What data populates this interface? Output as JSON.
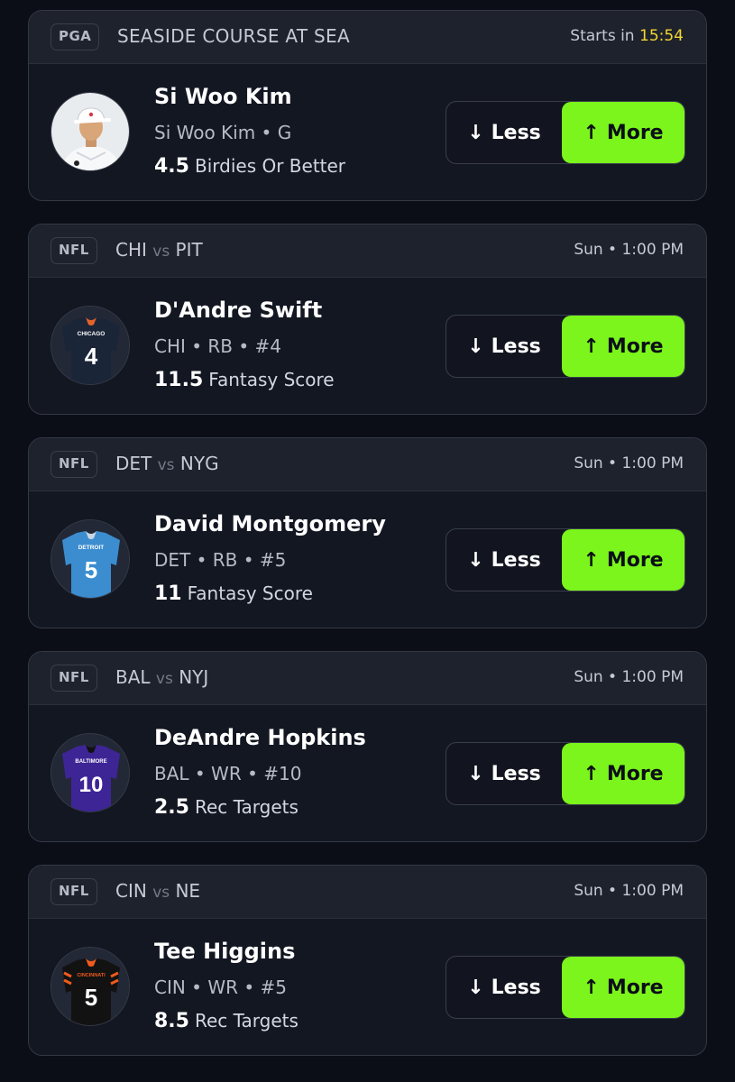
{
  "cards": [
    {
      "league": "PGA",
      "event": "SEASIDE COURSE AT SEA",
      "time_prefix": "Starts in",
      "countdown": "15:54",
      "player": "Si Woo Kim",
      "info": "Si Woo Kim • G",
      "line": "4.5",
      "stat": "Birdies Or Better",
      "less_label": "Less",
      "more_label": "More",
      "avatar": "golfer-photo"
    },
    {
      "league": "NFL",
      "team_a": "CHI",
      "vs": "vs",
      "team_b": "PIT",
      "time": "Sun • 1:00 PM",
      "player": "D'Andre Swift",
      "info": "CHI • RB • #4",
      "line": "11.5",
      "stat": "Fantasy Score",
      "less_label": "Less",
      "more_label": "More",
      "jersey": {
        "team": "CHICAGO",
        "number": "4",
        "color": "#1b2538",
        "accent": "#e4622a"
      }
    },
    {
      "league": "NFL",
      "team_a": "DET",
      "vs": "vs",
      "team_b": "NYG",
      "time": "Sun • 1:00 PM",
      "player": "David Montgomery",
      "info": "DET • RB • #5",
      "line": "11",
      "stat": "Fantasy Score",
      "less_label": "Less",
      "more_label": "More",
      "jersey": {
        "team": "DETROIT",
        "number": "5",
        "color": "#3b8dd0",
        "accent": "#c9d6e2"
      }
    },
    {
      "league": "NFL",
      "team_a": "BAL",
      "vs": "vs",
      "team_b": "NYJ",
      "time": "Sun • 1:00 PM",
      "player": "DeAndre Hopkins",
      "info": "BAL • WR • #10",
      "line": "2.5",
      "stat": "Rec Targets",
      "less_label": "Less",
      "more_label": "More",
      "jersey": {
        "team": "BALTIMORE",
        "number": "10",
        "color": "#3d2596",
        "accent": "#111111"
      }
    },
    {
      "league": "NFL",
      "team_a": "CIN",
      "vs": "vs",
      "team_b": "NE",
      "time": "Sun • 1:00 PM",
      "player": "Tee Higgins",
      "info": "CIN • WR • #5",
      "line": "8.5",
      "stat": "Rec Targets",
      "less_label": "Less",
      "more_label": "More",
      "jersey": {
        "team": "CINCINNATI",
        "number": "5",
        "color": "#121212",
        "accent": "#f05a1c"
      }
    }
  ],
  "colors": {
    "more_button": "#7bf51b",
    "countdown": "#f2d630",
    "card_bg": "#131722",
    "page_bg": "#0b0e17"
  },
  "icons": {
    "less": "arrow-down-icon",
    "more": "arrow-up-icon"
  }
}
